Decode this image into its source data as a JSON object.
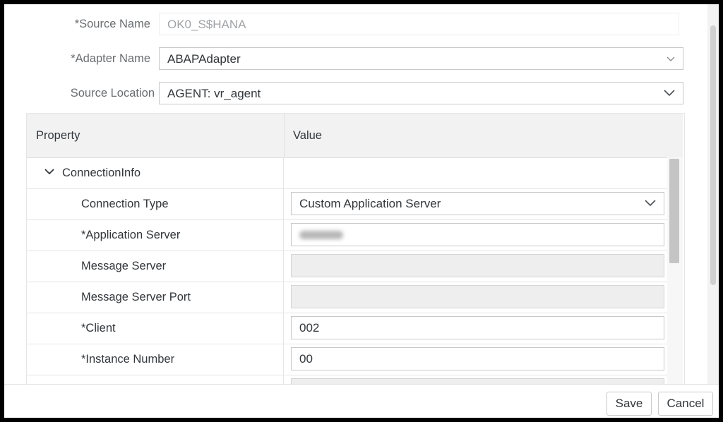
{
  "form": {
    "source_name_label": "*Source Name",
    "source_name_value": "OK0_S$HANA",
    "adapter_name_label": "*Adapter Name",
    "adapter_name_value": "ABAPAdapter",
    "source_location_label": "Source Location",
    "source_location_value": "AGENT: vr_agent"
  },
  "grid": {
    "header_property": "Property",
    "header_value": "Value",
    "group_label": "ConnectionInfo",
    "rows": [
      {
        "label": "Connection Type",
        "value": "Custom Application Server"
      },
      {
        "label": "*Application Server",
        "value": ""
      },
      {
        "label": "Message Server",
        "value": ""
      },
      {
        "label": "Message Server Port",
        "value": ""
      },
      {
        "label": "*Client",
        "value": "002"
      },
      {
        "label": "*Instance Number",
        "value": "00"
      }
    ]
  },
  "footer": {
    "save_label": "Save",
    "cancel_label": "Cancel"
  },
  "icons": {
    "chevron_down": "chevron-down-icon",
    "expand_collapse": "chevron-down-icon"
  }
}
